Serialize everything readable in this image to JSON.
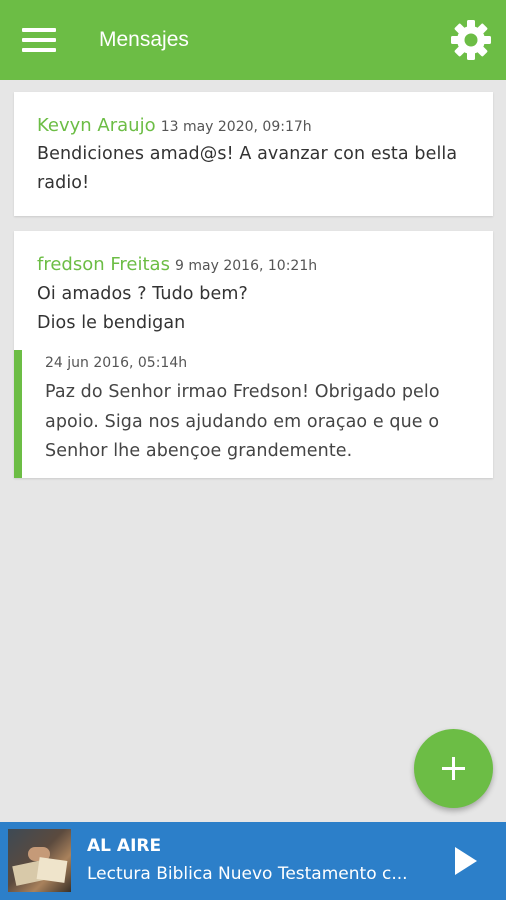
{
  "header": {
    "title": "Mensajes",
    "bg_color": "#6cbd45",
    "menu_icon": "hamburger-menu-icon",
    "settings_icon": "gear-icon"
  },
  "messages": [
    {
      "author": "Kevyn Araujo",
      "date": "13 may 2020, 09:17h",
      "lines": [
        "Bendiciones amad@s! A avanzar con esta bella",
        "radio!"
      ]
    },
    {
      "author": "fredson Freitas",
      "date": "9 may 2016, 10:21h",
      "lines": [
        "Oi amados ? Tudo bem?",
        "Dios le bendigan"
      ],
      "reply": {
        "date": "24 jun 2016, 05:14h",
        "lines": [
          "Paz do Senhor irmao Fredson! Obrigado pelo",
          "apoio. Siga nos ajudando em oraçao e que o",
          "Senhor lhe abençoe grandemente."
        ]
      }
    }
  ],
  "fab": {
    "icon": "plus-icon"
  },
  "player": {
    "status": "AL AIRE",
    "program": "Lectura Biblica Nuevo Testamento c...",
    "play_icon": "play-icon",
    "bg_color": "#2c7fc9"
  }
}
